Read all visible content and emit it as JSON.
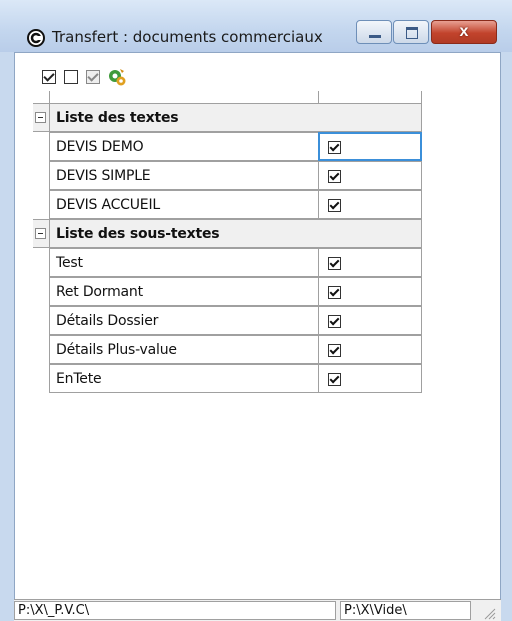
{
  "window": {
    "title": "Transfert : documents commerciaux",
    "close_label": "x"
  },
  "toolbar": {
    "items": [
      "check-all-icon",
      "uncheck-all-icon",
      "check-gray-icon",
      "transfer-icon"
    ]
  },
  "groups": [
    {
      "label": "Liste des textes",
      "rows": [
        {
          "name": "DEVIS DEMO",
          "checked": true
        },
        {
          "name": "DEVIS SIMPLE",
          "checked": true
        },
        {
          "name": "DEVIS ACCUEIL",
          "checked": true
        }
      ]
    },
    {
      "label": "Liste des sous-textes",
      "rows": [
        {
          "name": "Test",
          "checked": true
        },
        {
          "name": "Ret Dormant",
          "checked": true
        },
        {
          "name": "Détails Dossier",
          "checked": true
        },
        {
          "name": "Détails Plus-value",
          "checked": true
        },
        {
          "name": "EnTete",
          "checked": true
        }
      ]
    }
  ],
  "status": {
    "left_path": "P:\\X\\_P.V.C\\",
    "right_path": "P:\\X\\Vide\\"
  }
}
